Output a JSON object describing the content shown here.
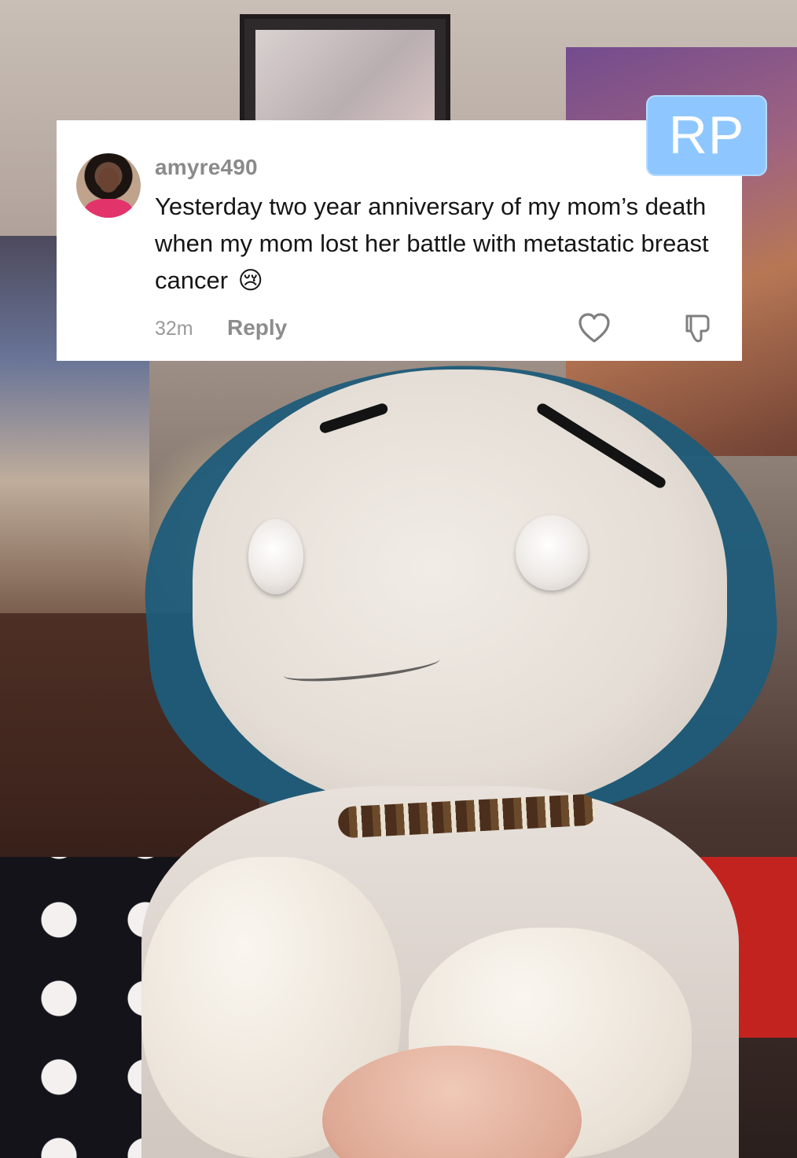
{
  "comment": {
    "username": "amyre490",
    "text": "Yesterday two year anniversary of my mom’s death when my mom lost her battle with metastatic breast cancer",
    "emoji": "😢",
    "timestamp": "32m",
    "reply_label": "Reply",
    "icons": {
      "avatar": "user-avatar",
      "like": "heart-outline-icon",
      "dislike": "thumbs-down-outline-icon"
    }
  },
  "badge": {
    "label": "RP",
    "color": "#8ec7ff"
  },
  "colors": {
    "card_background": "#ffffff",
    "username": "#8a8a8a",
    "comment_text": "#161616",
    "meta": "#9a9a9a"
  }
}
